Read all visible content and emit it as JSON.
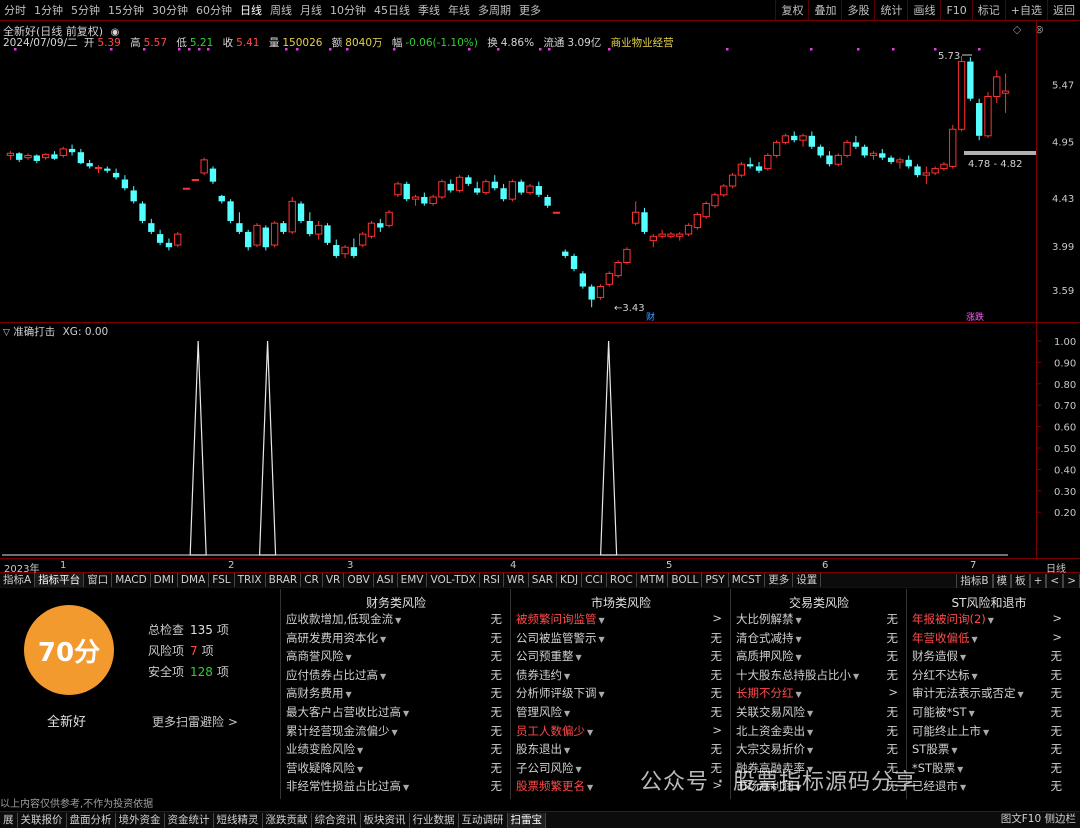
{
  "toolbar": {
    "timeframes": [
      "分时",
      "1分钟",
      "5分钟",
      "15分钟",
      "30分钟",
      "60分钟",
      "日线",
      "周线",
      "月线",
      "10分钟",
      "45日线",
      "季线",
      "年线",
      "多周期",
      "更多"
    ],
    "active_timeframe": "日线",
    "tools": [
      "复权",
      "叠加",
      "多股",
      "统计",
      "画线",
      "F10",
      "标记",
      "+自选",
      "返回"
    ]
  },
  "stock": {
    "title": "全新好(日线 前复权)",
    "date": "2024/07/09/二",
    "open_label": "开",
    "open": "5.39",
    "high_label": "高",
    "high": "5.57",
    "low_label": "低",
    "low": "5.21",
    "close_label": "收",
    "close": "5.41",
    "volume_label": "量",
    "volume": "150026",
    "amount_label": "额",
    "amount": "8040万",
    "change_label": "幅",
    "change": "-0.06(-1.10%)",
    "turnover_label": "换",
    "turnover": "4.86%",
    "float_label": "流通",
    "float_cap": "3.09亿",
    "sector": "商业物业经营"
  },
  "price_axis": {
    "ticks": [
      "5.47",
      "4.95",
      "4.43",
      "3.99",
      "3.59"
    ],
    "high_marker": "5.73",
    "low_marker": "3.43",
    "range_box": "4.78 - 4.82",
    "marker_cai": "财",
    "marker_zhangting": "涨跌"
  },
  "indicator": {
    "title": "准确打击",
    "xg_label": "XG:",
    "xg_value": "0.00",
    "axis_ticks": [
      "1.00",
      "0.90",
      "0.80",
      "0.70",
      "0.60",
      "0.50",
      "0.40",
      "0.30",
      "0.20"
    ]
  },
  "date_axis": {
    "labels": [
      "2023年",
      "1",
      "2",
      "3",
      "4",
      "5",
      "6",
      "7"
    ],
    "period": "日线"
  },
  "indicator_tabs": {
    "items": [
      "指标A",
      "指标平台",
      "窗口",
      "MACD",
      "DMI",
      "DMA",
      "FSL",
      "TRIX",
      "BRAR",
      "CR",
      "VR",
      "OBV",
      "ASI",
      "EMV",
      "VOL-TDX",
      "RSI",
      "WR",
      "SAR",
      "KDJ",
      "CCI",
      "ROC",
      "MTM",
      "BOLL",
      "PSY",
      "MCST",
      "更多",
      "设置"
    ],
    "active": "指标平台",
    "right": [
      "指标B",
      "模",
      "板",
      "+",
      "<",
      ">"
    ]
  },
  "scan": {
    "score": "70分",
    "stock_name": "全新好",
    "total_label": "总检查",
    "total": "135",
    "total_unit": "项",
    "risk_label": "风险项",
    "risk": "7",
    "risk_unit": "项",
    "safe_label": "安全项",
    "safe": "128",
    "safe_unit": "项",
    "more": "更多扫雷避险 >",
    "disclaimer": "以上内容仅供参考,不作为投资依据"
  },
  "risk_columns": [
    {
      "title": "财务类风险",
      "items": [
        {
          "label": "应收款增加,低现金流",
          "value": "无",
          "alert": false
        },
        {
          "label": "高研发费用资本化",
          "value": "无",
          "alert": false
        },
        {
          "label": "高商誉风险",
          "value": "无",
          "alert": false
        },
        {
          "label": "应付债券占比过高",
          "value": "无",
          "alert": false
        },
        {
          "label": "高财务费用",
          "value": "无",
          "alert": false
        },
        {
          "label": "最大客户占营收比过高",
          "value": "无",
          "alert": false
        },
        {
          "label": "累计经营现金流偏少",
          "value": "无",
          "alert": false
        },
        {
          "label": "业绩变脸风险",
          "value": "无",
          "alert": false
        },
        {
          "label": "营收疑降风险",
          "value": "无",
          "alert": false
        },
        {
          "label": "非经常性损益占比过高",
          "value": "无",
          "alert": false
        }
      ]
    },
    {
      "title": "市场类风险",
      "items": [
        {
          "label": "被频繁问询监管",
          "value": ">",
          "alert": true
        },
        {
          "label": "公司被监管警示",
          "value": "无",
          "alert": false
        },
        {
          "label": "公司预重整",
          "value": "无",
          "alert": false
        },
        {
          "label": "债券违约",
          "value": "无",
          "alert": false
        },
        {
          "label": "分析师评级下调",
          "value": "无",
          "alert": false
        },
        {
          "label": "管理风险",
          "value": "无",
          "alert": false
        },
        {
          "label": "员工人数偏少",
          "value": ">",
          "alert": true
        },
        {
          "label": "股东退出",
          "value": "无",
          "alert": false
        },
        {
          "label": "子公司风险",
          "value": "无",
          "alert": false
        },
        {
          "label": "股票频繁更名",
          "value": ">",
          "alert": true
        }
      ]
    },
    {
      "title": "交易类风险",
      "items": [
        {
          "label": "大比例解禁",
          "value": "无",
          "alert": false
        },
        {
          "label": "清仓式减持",
          "value": "无",
          "alert": false
        },
        {
          "label": "高质押风险",
          "value": "无",
          "alert": false
        },
        {
          "label": "十大股东总持股占比小",
          "value": "无",
          "alert": false
        },
        {
          "label": "长期不分红",
          "value": ">",
          "alert": true
        },
        {
          "label": "关联交易风险",
          "value": "无",
          "alert": false
        },
        {
          "label": "北上资金卖出",
          "value": "无",
          "alert": false
        },
        {
          "label": "大宗交易折价",
          "value": "无",
          "alert": false
        },
        {
          "label": "融券高融卖率",
          "value": "无",
          "alert": false
        },
        {
          "label": "市场高利润",
          "value": "无",
          "alert": false
        }
      ]
    },
    {
      "title": "ST风险和退市",
      "items": [
        {
          "label": "年报被问询(2)",
          "value": ">",
          "alert": true
        },
        {
          "label": "年营收偏低",
          "value": ">",
          "alert": true
        },
        {
          "label": "财务造假",
          "value": "无",
          "alert": false
        },
        {
          "label": "分红不达标",
          "value": "无",
          "alert": false
        },
        {
          "label": "审计无法表示或否定",
          "value": "无",
          "alert": false
        },
        {
          "label": "可能被*ST",
          "value": "无",
          "alert": false
        },
        {
          "label": "可能终止上市",
          "value": "无",
          "alert": false
        },
        {
          "label": "ST股票",
          "value": "无",
          "alert": false
        },
        {
          "label": "*ST股票",
          "value": "无",
          "alert": false
        },
        {
          "label": "已经退市",
          "value": "无",
          "alert": false
        }
      ]
    }
  ],
  "statusbar": {
    "items": [
      "展",
      "关联报价",
      "盘面分析",
      "境外资金",
      "资金统计",
      "短线精灵",
      "涨跌贡献",
      "综合资讯",
      "板块资讯",
      "行业数据",
      "互动调研",
      "扫雷宝"
    ],
    "active": "扫雷宝",
    "right": "图文F10 侧边栏"
  },
  "watermark": "公众号 · 股票指标源码分享",
  "colors": {
    "up": "#ff3232",
    "down": "#54ffff",
    "grid": "#7a0000",
    "accent": "#f39a2f"
  },
  "chart_data": {
    "type": "candlestick",
    "candles": [
      [
        4.82,
        4.86,
        4.78,
        4.84
      ],
      [
        4.84,
        4.85,
        4.76,
        4.78
      ],
      [
        4.8,
        4.84,
        4.78,
        4.82
      ],
      [
        4.82,
        4.83,
        4.75,
        4.77
      ],
      [
        4.8,
        4.84,
        4.78,
        4.83
      ],
      [
        4.83,
        4.86,
        4.78,
        4.79
      ],
      [
        4.82,
        4.9,
        4.8,
        4.88
      ],
      [
        4.88,
        4.92,
        4.82,
        4.85
      ],
      [
        4.85,
        4.88,
        4.74,
        4.75
      ],
      [
        4.75,
        4.78,
        4.7,
        4.72
      ],
      [
        4.7,
        4.73,
        4.66,
        4.71
      ],
      [
        4.7,
        4.72,
        4.66,
        4.68
      ],
      [
        4.66,
        4.7,
        4.6,
        4.62
      ],
      [
        4.6,
        4.64,
        4.5,
        4.52
      ],
      [
        4.5,
        4.54,
        4.38,
        4.4
      ],
      [
        4.38,
        4.4,
        4.2,
        4.22
      ],
      [
        4.2,
        4.24,
        4.1,
        4.12
      ],
      [
        4.1,
        4.14,
        4.0,
        4.02
      ],
      [
        4.02,
        4.06,
        3.95,
        3.98
      ],
      [
        4.0,
        4.12,
        3.98,
        4.1
      ],
      [
        4.52,
        4.52,
        4.52,
        4.52
      ],
      [
        4.6,
        4.6,
        4.6,
        4.6
      ],
      [
        4.66,
        4.8,
        4.64,
        4.78
      ],
      [
        4.7,
        4.72,
        4.56,
        4.58
      ],
      [
        4.45,
        4.46,
        4.38,
        4.4
      ],
      [
        4.4,
        4.42,
        4.2,
        4.22
      ],
      [
        4.2,
        4.3,
        4.1,
        4.12
      ],
      [
        4.12,
        4.14,
        3.95,
        3.98
      ],
      [
        4.0,
        4.2,
        3.98,
        4.18
      ],
      [
        4.16,
        4.18,
        3.95,
        3.98
      ],
      [
        4.0,
        4.22,
        3.98,
        4.2
      ],
      [
        4.2,
        4.22,
        4.1,
        4.12
      ],
      [
        4.12,
        4.44,
        4.1,
        4.4
      ],
      [
        4.38,
        4.4,
        4.2,
        4.22
      ],
      [
        4.22,
        4.3,
        4.08,
        4.1
      ],
      [
        4.1,
        4.22,
        4.05,
        4.18
      ],
      [
        4.18,
        4.2,
        4.0,
        4.02
      ],
      [
        4.0,
        4.05,
        3.88,
        3.9
      ],
      [
        3.92,
        4.0,
        3.88,
        3.98
      ],
      [
        3.98,
        4.06,
        3.88,
        3.9
      ],
      [
        4.0,
        4.12,
        3.98,
        4.1
      ],
      [
        4.08,
        4.22,
        4.06,
        4.2
      ],
      [
        4.2,
        4.24,
        4.12,
        4.16
      ],
      [
        4.18,
        4.32,
        4.16,
        4.3
      ],
      [
        4.46,
        4.58,
        4.44,
        4.56
      ],
      [
        4.56,
        4.58,
        4.4,
        4.42
      ],
      [
        4.42,
        4.46,
        4.36,
        4.44
      ],
      [
        4.44,
        4.48,
        4.36,
        4.38
      ],
      [
        4.38,
        4.46,
        4.36,
        4.44
      ],
      [
        4.44,
        4.6,
        4.42,
        4.58
      ],
      [
        4.56,
        4.6,
        4.48,
        4.5
      ],
      [
        4.5,
        4.64,
        4.48,
        4.62
      ],
      [
        4.62,
        4.64,
        4.54,
        4.56
      ],
      [
        4.52,
        4.58,
        4.46,
        4.48
      ],
      [
        4.48,
        4.6,
        4.46,
        4.58
      ],
      [
        4.58,
        4.64,
        4.5,
        4.52
      ],
      [
        4.52,
        4.56,
        4.4,
        4.42
      ],
      [
        4.42,
        4.6,
        4.4,
        4.58
      ],
      [
        4.58,
        4.6,
        4.46,
        4.48
      ],
      [
        4.48,
        4.56,
        4.46,
        4.54
      ],
      [
        4.54,
        4.58,
        4.44,
        4.46
      ],
      [
        4.44,
        4.46,
        4.34,
        4.36
      ],
      [
        4.3,
        4.3,
        4.3,
        4.3
      ],
      [
        3.94,
        3.96,
        3.88,
        3.9
      ],
      [
        3.9,
        3.92,
        3.76,
        3.78
      ],
      [
        3.74,
        3.76,
        3.6,
        3.62
      ],
      [
        3.62,
        3.64,
        3.43,
        3.5
      ],
      [
        3.52,
        3.64,
        3.5,
        3.62
      ],
      [
        3.64,
        3.76,
        3.62,
        3.74
      ],
      [
        3.72,
        3.86,
        3.7,
        3.84
      ],
      [
        3.84,
        3.98,
        3.82,
        3.96
      ],
      [
        4.2,
        4.4,
        4.18,
        4.3
      ],
      [
        4.3,
        4.34,
        4.1,
        4.12
      ],
      [
        4.04,
        4.1,
        3.98,
        4.08
      ],
      [
        4.08,
        4.14,
        4.06,
        4.1
      ],
      [
        4.08,
        4.12,
        4.06,
        4.1
      ],
      [
        4.08,
        4.12,
        4.04,
        4.1
      ],
      [
        4.1,
        4.2,
        4.08,
        4.18
      ],
      [
        4.16,
        4.3,
        4.14,
        4.28
      ],
      [
        4.26,
        4.4,
        4.24,
        4.38
      ],
      [
        4.36,
        4.48,
        4.34,
        4.46
      ],
      [
        4.46,
        4.56,
        4.44,
        4.54
      ],
      [
        4.54,
        4.66,
        4.52,
        4.64
      ],
      [
        4.64,
        4.76,
        4.62,
        4.74
      ],
      [
        4.74,
        4.8,
        4.7,
        4.72
      ],
      [
        4.72,
        4.76,
        4.66,
        4.68
      ],
      [
        4.7,
        4.84,
        4.68,
        4.82
      ],
      [
        4.82,
        4.96,
        4.8,
        4.94
      ],
      [
        4.94,
        5.02,
        4.92,
        5.0
      ],
      [
        5.0,
        5.04,
        4.94,
        4.96
      ],
      [
        4.96,
        5.02,
        4.9,
        5.0
      ],
      [
        5.0,
        5.04,
        4.88,
        4.9
      ],
      [
        4.9,
        4.92,
        4.8,
        4.82
      ],
      [
        4.82,
        4.86,
        4.72,
        4.74
      ],
      [
        4.74,
        4.84,
        4.72,
        4.82
      ],
      [
        4.82,
        4.96,
        4.8,
        4.94
      ],
      [
        4.94,
        5.0,
        4.88,
        4.9
      ],
      [
        4.9,
        4.92,
        4.8,
        4.82
      ],
      [
        4.82,
        4.86,
        4.78,
        4.84
      ],
      [
        4.84,
        4.88,
        4.78,
        4.8
      ],
      [
        4.8,
        4.82,
        4.74,
        4.76
      ],
      [
        4.76,
        4.8,
        4.7,
        4.78
      ],
      [
        4.78,
        4.82,
        4.7,
        4.72
      ],
      [
        4.72,
        4.74,
        4.62,
        4.64
      ],
      [
        4.64,
        4.72,
        4.56,
        4.66
      ],
      [
        4.66,
        4.72,
        4.64,
        4.7
      ],
      [
        4.7,
        4.76,
        4.68,
        4.74
      ],
      [
        4.72,
        5.1,
        4.7,
        5.06
      ],
      [
        5.06,
        5.73,
        5.04,
        5.68
      ],
      [
        5.68,
        5.72,
        5.32,
        5.34
      ],
      [
        5.3,
        5.34,
        4.96,
        5.0
      ],
      [
        5.0,
        5.4,
        4.98,
        5.36
      ],
      [
        5.36,
        5.6,
        5.3,
        5.54
      ],
      [
        5.39,
        5.57,
        5.21,
        5.41
      ]
    ],
    "signal": [
      {
        "x": 0.195,
        "value": 1.0
      },
      {
        "x": 0.264,
        "value": 1.0
      },
      {
        "x": 0.603,
        "value": 1.0
      }
    ],
    "ylim": [
      3.35,
      5.85
    ]
  }
}
